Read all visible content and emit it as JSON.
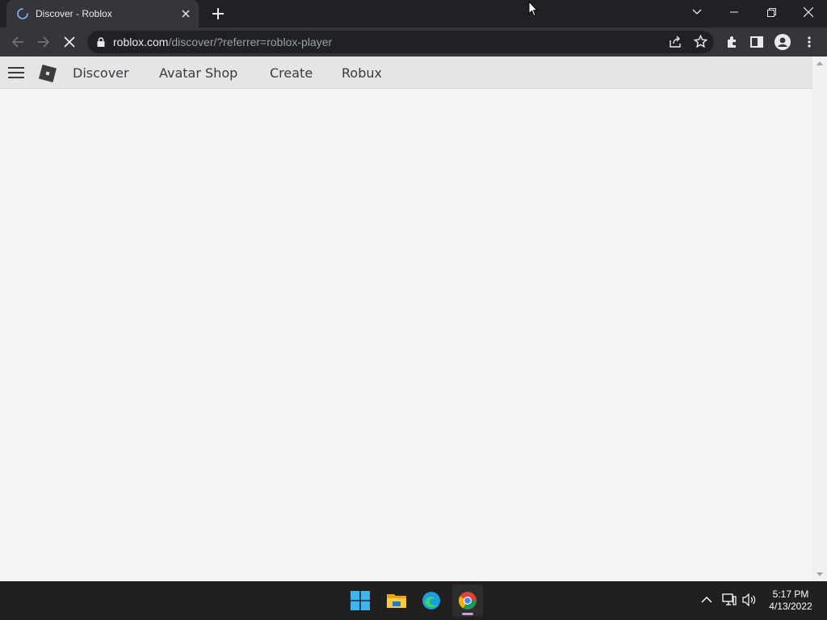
{
  "browser": {
    "tab_title": "Discover - Roblox",
    "url_host": "roblox.com",
    "url_path": "/discover/?referrer=roblox-player"
  },
  "roblox_nav": {
    "links": [
      "Discover",
      "Avatar Shop",
      "Create",
      "Robux"
    ]
  },
  "taskbar": {
    "time": "5:17 PM",
    "date": "4/13/2022"
  },
  "colors": {
    "page_bg": "#f2f4f5",
    "nav_bg": "#e3e5e7",
    "chrome_dark": "#202124",
    "chrome_toolbar": "#35363a"
  }
}
